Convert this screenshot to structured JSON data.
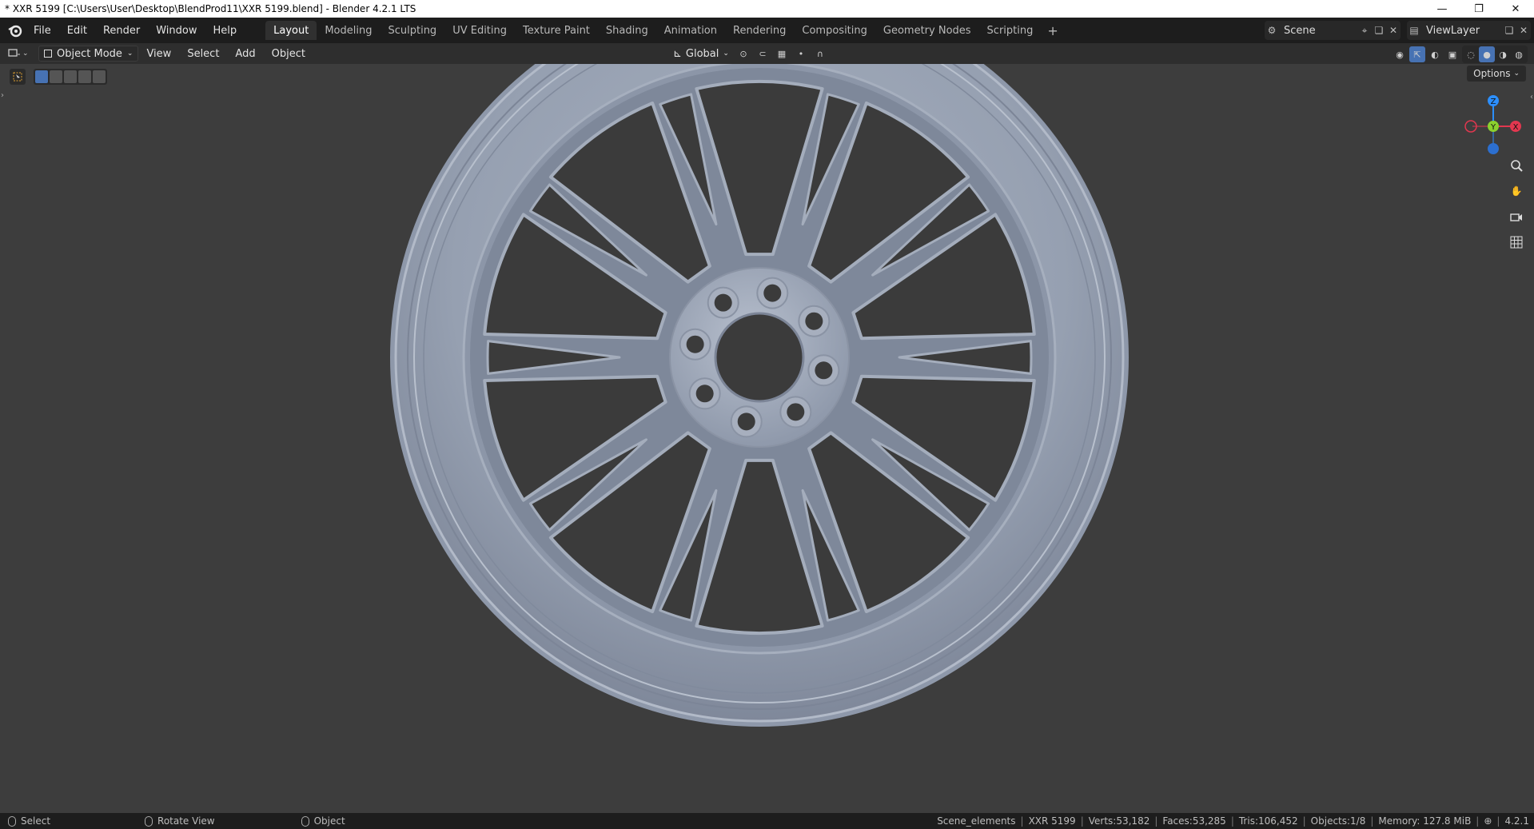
{
  "window": {
    "title": "* XXR 5199 [C:\\Users\\User\\Desktop\\BlendProd11\\XXR 5199.blend] - Blender 4.2.1 LTS",
    "controls": [
      "—",
      "❐",
      "✕"
    ]
  },
  "topbar": {
    "menus": [
      "File",
      "Edit",
      "Render",
      "Window",
      "Help"
    ],
    "workspaces": [
      "Layout",
      "Modeling",
      "Sculpting",
      "UV Editing",
      "Texture Paint",
      "Shading",
      "Animation",
      "Rendering",
      "Compositing",
      "Geometry Nodes",
      "Scripting"
    ],
    "active_workspace": "Layout",
    "add_workspace": "+",
    "scene_name": "Scene",
    "view_layer": "ViewLayer"
  },
  "viewport_header": {
    "mode": "Object Mode",
    "menus": [
      "View",
      "Select",
      "Add",
      "Object"
    ],
    "orientation": "Global"
  },
  "viewport": {
    "options_label": "Options",
    "gizmo": {
      "z_label": "Z",
      "y_label": "Y",
      "x_label": "X",
      "colors": {
        "x": "#e2374f",
        "y": "#8bd12e",
        "z": "#2c8fff"
      }
    },
    "nav_icons": [
      "zoom-icon",
      "pan-hand-icon",
      "camera-icon",
      "grid-icon"
    ],
    "object_color": "#9aa3b4",
    "background_color": "#3d3d3d"
  },
  "statusbar": {
    "left": [
      {
        "label": "Select"
      },
      {
        "label": "Rotate View"
      },
      {
        "label": "Object"
      }
    ],
    "collection": "Scene_elements",
    "object": "XXR 5199",
    "verts": "Verts:53,182",
    "faces": "Faces:53,285",
    "tris": "Tris:106,452",
    "objects": "Objects:1/8",
    "memory": "Memory: 127.8 MiB",
    "version": "4.2.1"
  }
}
